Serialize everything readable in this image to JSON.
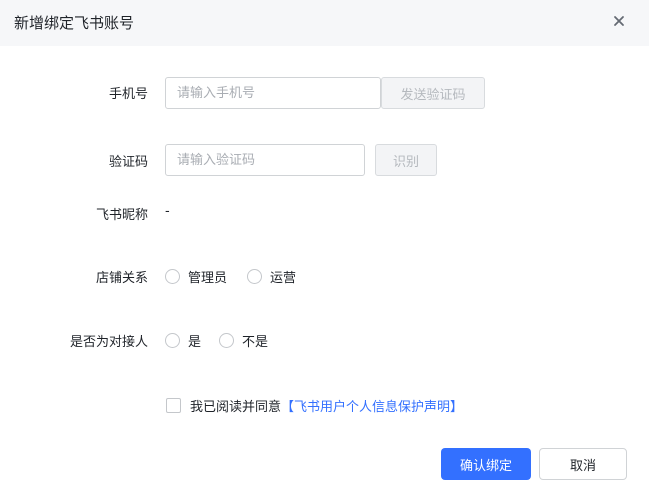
{
  "dialog": {
    "title": "新增绑定飞书账号"
  },
  "form": {
    "phone": {
      "label": "手机号",
      "placeholder": "请输入手机号",
      "value": "",
      "send_code_label": "发送验证码"
    },
    "code": {
      "label": "验证码",
      "placeholder": "请输入验证码",
      "value": "",
      "recognize_label": "识别"
    },
    "nickname": {
      "label": "飞书昵称",
      "value": "-"
    },
    "store_relation": {
      "label": "店铺关系",
      "options": [
        "管理员",
        "运营"
      ]
    },
    "contact_person": {
      "label": "是否为对接人",
      "options": [
        "是",
        "不是"
      ]
    },
    "agreement": {
      "text": "我已阅读并同意",
      "link": "【飞书用户个人信息保护声明】"
    }
  },
  "footer": {
    "confirm_label": "确认绑定",
    "cancel_label": "取消"
  },
  "colors": {
    "primary": "#3370ff",
    "header_bg": "#f6f7f9",
    "border": "#d0d3d6"
  },
  "icons": {
    "close": "close-icon"
  }
}
